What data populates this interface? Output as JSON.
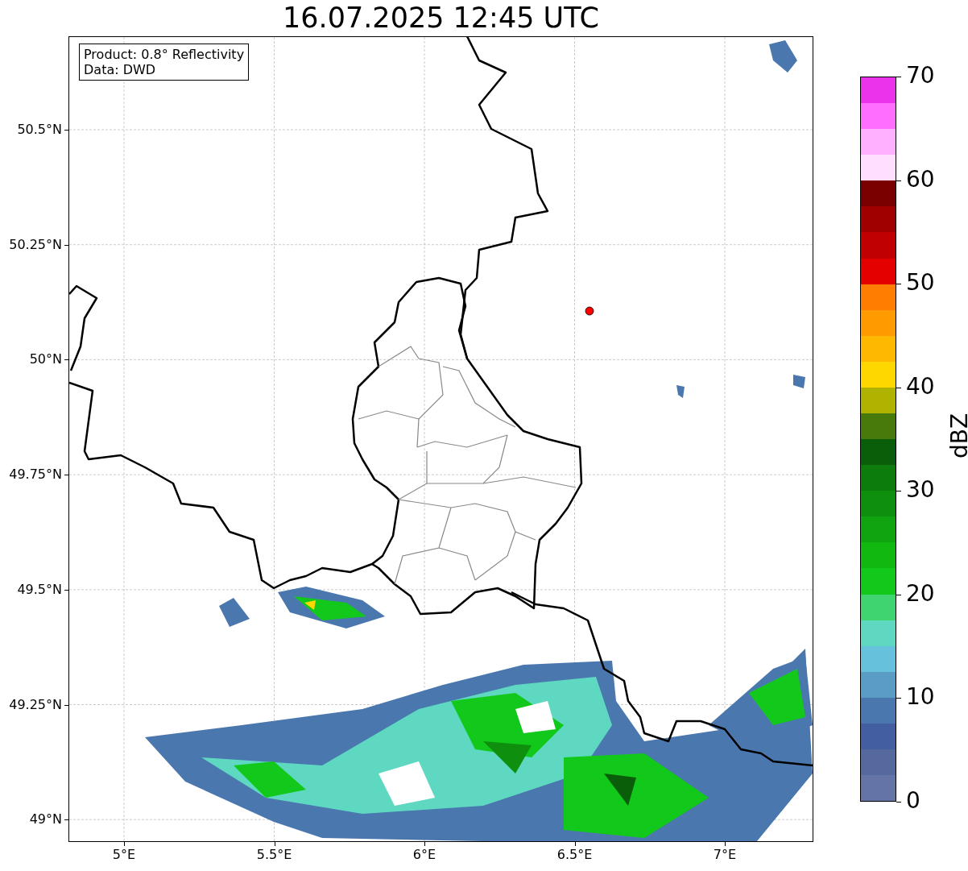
{
  "title": "16.07.2025 12:45 UTC",
  "legend": [
    "Product: 0.8° Reflectivity",
    "Data: DWD"
  ],
  "map": {
    "xticks": [
      "5°E",
      "5.5°E",
      "6°E",
      "6.5°E",
      "7°E"
    ],
    "yticks": [
      "50.5°N",
      "50.25°N",
      "50°N",
      "49.75°N",
      "49.5°N",
      "49.25°N",
      "49°N"
    ]
  },
  "colorbar": {
    "label": "dBZ",
    "ticks": [
      "70",
      "60",
      "50",
      "40",
      "30",
      "20",
      "10",
      "0"
    ],
    "segments": [
      {
        "color": "#ea33ea"
      },
      {
        "color": "#ff6eff"
      },
      {
        "color": "#ffb0ff"
      },
      {
        "color": "#ffdfff"
      },
      {
        "color": "#7a0000"
      },
      {
        "color": "#a00000"
      },
      {
        "color": "#c00000"
      },
      {
        "color": "#e50000"
      },
      {
        "color": "#ff7d00"
      },
      {
        "color": "#ff9a00"
      },
      {
        "color": "#ffb800"
      },
      {
        "color": "#ffd700"
      },
      {
        "color": "#afb300"
      },
      {
        "color": "#477a0a"
      },
      {
        "color": "#0a5e0a"
      },
      {
        "color": "#0c7c0c"
      },
      {
        "color": "#0e900e"
      },
      {
        "color": "#10a510"
      },
      {
        "color": "#10b810"
      },
      {
        "color": "#12c81a"
      },
      {
        "color": "#3fd470"
      },
      {
        "color": "#5fd8c2"
      },
      {
        "color": "#66c2dc"
      },
      {
        "color": "#5a9cc4"
      },
      {
        "color": "#4a78ae"
      },
      {
        "color": "#445ea2"
      },
      {
        "color": "#56699e"
      },
      {
        "color": "#6474a6"
      }
    ]
  }
}
